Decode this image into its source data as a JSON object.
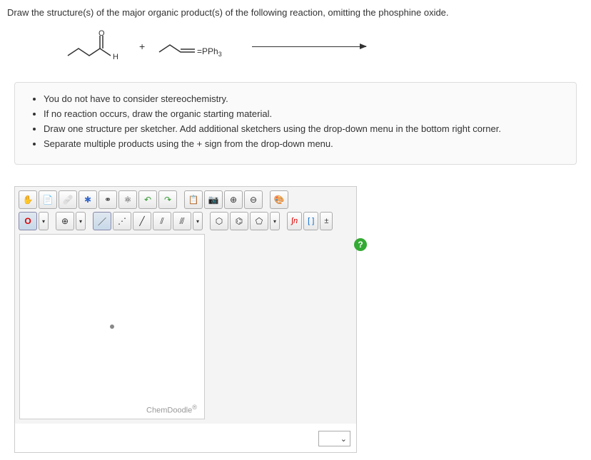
{
  "prompt": "Draw the structure(s) of the major organic product(s) of the following reaction, omitting the phosphine oxide.",
  "reaction": {
    "aldehyde_label": "H",
    "plus": "+",
    "ylide_label": "=PPh",
    "ylide_sub": "3"
  },
  "instructions": {
    "items": [
      "You do not have to consider stereochemistry.",
      "If no reaction occurs, draw the organic starting material.",
      "Draw one structure per sketcher. Add additional sketchers using the drop-down menu in the bottom right corner.",
      "Separate multiple products using the + sign from the drop-down menu."
    ]
  },
  "sketcher": {
    "row1": {
      "hand": "✋",
      "open": "📄",
      "erase": "🩹",
      "center": "✱",
      "clean": "⚭",
      "mol": "⚛",
      "undo": "↶",
      "redo": "↷",
      "paste": "📋",
      "copy": "📷",
      "zoomin": "⊕",
      "zoomout": "⊖",
      "color": "🎨"
    },
    "row2": {
      "atom_o": "O",
      "caret": "▾",
      "charge": "⊕",
      "bond1": "／",
      "bond2": "⋰",
      "bond3": "╱",
      "bond4": "⫽",
      "bond5": "⫻",
      "ring6": "⬡",
      "benz": "⌬",
      "ring5": "⬠",
      "lewis": "∫n",
      "bracket": "[ ]",
      "iso": "±"
    },
    "help": "?",
    "brand": "ChemDoodle",
    "brand_reg": "®",
    "dropdown_caret": "⌄"
  }
}
